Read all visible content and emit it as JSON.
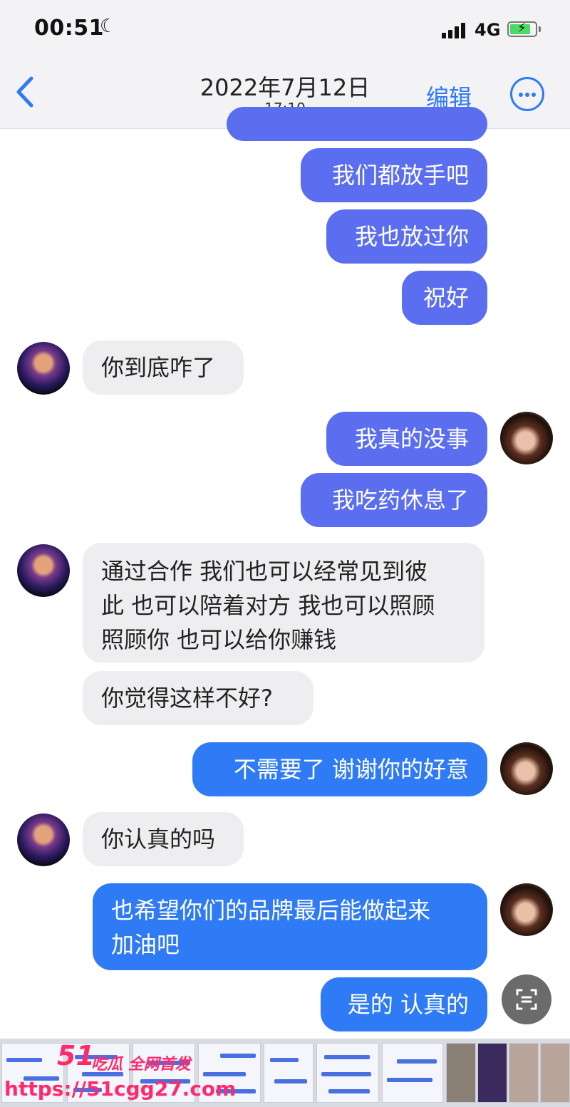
{
  "status_bar": {
    "time": "00:51",
    "network": "4G"
  },
  "nav": {
    "title": "2022年7月12日",
    "subtitle": "17:10",
    "edit_label": "编辑"
  },
  "messages": [
    {
      "side": "out",
      "text": "我们都放手吧"
    },
    {
      "side": "out",
      "text": "我也放过你"
    },
    {
      "side": "out",
      "text": "祝好"
    },
    {
      "side": "in",
      "text": "你到底咋了"
    },
    {
      "side": "out",
      "text": "我真的没事"
    },
    {
      "side": "out",
      "text": "我吃药休息了"
    },
    {
      "side": "in",
      "lines": [
        "通过合作 我们也可以经常见到彼",
        "此 也可以陪着对方 我也可以照顾",
        "照顾你 也可以给你赚钱"
      ]
    },
    {
      "side": "in",
      "text": "你觉得这样不好?"
    },
    {
      "side": "out",
      "text": "不需要了 谢谢你的好意"
    },
    {
      "side": "in",
      "text": "你认真的吗"
    },
    {
      "side": "out",
      "lines": [
        "也希望你们的品牌最后能做起来",
        "加油吧"
      ]
    },
    {
      "side": "out",
      "text": "是的 认真的"
    }
  ],
  "watermark": {
    "brand": "51",
    "tagline": "吃瓜 全网首发",
    "url": "https://51cgg27.com"
  },
  "colors": {
    "outgoing": "#5b6ef0",
    "outgoing_blue": "#2f7bf5",
    "incoming": "#eeeef0",
    "accent": "#2f7bf5",
    "watermark": "#ff2a6b"
  }
}
